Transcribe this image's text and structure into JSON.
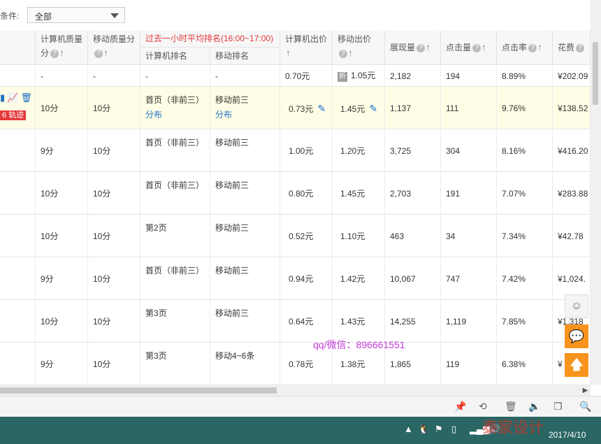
{
  "filter": {
    "label": "条件:",
    "selected": "全部"
  },
  "header": {
    "pc_quality": "计算机质量",
    "pc_quality_2": "分",
    "mobile_quality": "移动质量分",
    "group_title": "过去一小时平均排名(16:00~17:00)",
    "pc_rank": "计算机排名",
    "mobile_rank": "移动排名",
    "pc_bid": "计算机出价",
    "mobile_bid": "移动出价",
    "impressions": "展现量",
    "clicks": "点击量",
    "ctr": "点击率",
    "cost": "花费"
  },
  "row_actions": {
    "track_label": "轨迹",
    "track_prefix": "6"
  },
  "rows": [
    {
      "pcq": "-",
      "mq": "-",
      "pcr": "-",
      "mr": "-",
      "pcb": "0.70元",
      "mb": "1.05元",
      "mb_tag": "折",
      "imp": "2,182",
      "clk": "194",
      "ctr": "8.89%",
      "cost": "¥202.09"
    },
    {
      "pcq": "10分",
      "mq": "10分",
      "pcr": "首页（非前三）",
      "pcr_link": "分布",
      "mr": "移动前三",
      "mr_link": "分布",
      "pcb": "0.73元",
      "mb": "1.45元",
      "imp": "1,137",
      "clk": "111",
      "ctr": "9.76%",
      "cost": "¥138.52"
    },
    {
      "pcq": "9分",
      "mq": "10分",
      "pcr": "首页（非前三）",
      "mr": "移动前三",
      "pcb": "1.00元",
      "mb": "1.20元",
      "imp": "3,725",
      "clk": "304",
      "ctr": "8.16%",
      "cost": "¥416.20"
    },
    {
      "pcq": "10分",
      "mq": "10分",
      "pcr": "首页（非前三）",
      "mr": "移动前三",
      "pcb": "0.80元",
      "mb": "1.45元",
      "imp": "2,703",
      "clk": "191",
      "ctr": "7.07%",
      "cost": "¥283.88"
    },
    {
      "pcq": "10分",
      "mq": "10分",
      "pcr": "第2页",
      "mr": "移动前三",
      "pcb": "0.52元",
      "mb": "1.10元",
      "imp": "463",
      "clk": "34",
      "ctr": "7.34%",
      "cost": "¥42.78"
    },
    {
      "pcq": "9分",
      "mq": "10分",
      "pcr": "首页（非前三）",
      "mr": "移动前三",
      "pcb": "0.94元",
      "mb": "1.42元",
      "imp": "10,067",
      "clk": "747",
      "ctr": "7.42%",
      "cost": "¥1,024."
    },
    {
      "pcq": "10分",
      "mq": "10分",
      "pcr": "第3页",
      "mr": "移动前三",
      "pcb": "0.64元",
      "mb": "1.43元",
      "imp": "14,255",
      "clk": "1,119",
      "ctr": "7.85%",
      "cost": "¥1,318"
    },
    {
      "pcq": "9分",
      "mq": "10分",
      "pcr": "第3页",
      "mr": "移动4~6条",
      "pcb": "0.78元",
      "mb": "1.38元",
      "imp": "1,865",
      "clk": "119",
      "ctr": "6.38%",
      "cost": "¥"
    }
  ],
  "overlay_text": "qq/微信：896661551",
  "taskbar": {
    "date": "2017/4/10",
    "watermark": "泰家设计"
  },
  "colors": {
    "accent_red": "#e4393c",
    "link_blue": "#1e6fc5",
    "highlight_row": "#fffde5",
    "float_orange": "#f7941d",
    "taskbar": "#2a6664",
    "overlay_purple": "#c13ad8"
  }
}
